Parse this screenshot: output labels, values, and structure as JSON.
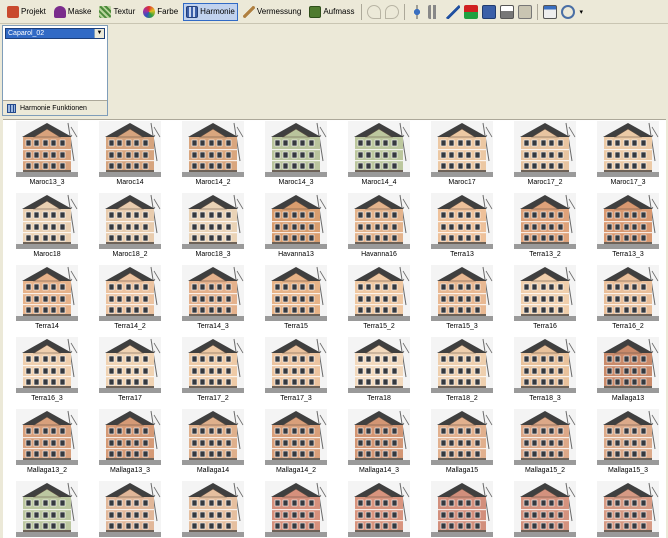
{
  "toolbar": {
    "items": [
      {
        "label": "Projekt",
        "icon": "projekt-icon",
        "color": "#c94a2e"
      },
      {
        "label": "Maske",
        "icon": "mask-icon",
        "color": "#7a2c8c"
      },
      {
        "label": "Textur",
        "icon": "texture-icon",
        "color": "#4b8b3a"
      },
      {
        "label": "Farbe",
        "icon": "color-wheel-icon",
        "color": "#e0a020"
      },
      {
        "label": "Harmonie",
        "icon": "harmony-icon",
        "color": "#3c5fa8",
        "active": true
      },
      {
        "label": "Vermessung",
        "icon": "measure-icon",
        "color": "#b08040"
      },
      {
        "label": "Aufmass",
        "icon": "aufmass-icon",
        "color": "#4f7b2e"
      }
    ]
  },
  "panel": {
    "selected_palette": "Caparol_02",
    "footer_label": "Harmonie Funktionen"
  },
  "gallery": {
    "items": [
      {
        "label": "Maroc13_3",
        "color": "#d8a27c"
      },
      {
        "label": "Maroc14",
        "color": "#d6a47e"
      },
      {
        "label": "Maroc14_2",
        "color": "#d9a67e"
      },
      {
        "label": "Maroc14_3",
        "color": "#b9c49c"
      },
      {
        "label": "Maroc14_4",
        "color": "#bcc79e"
      },
      {
        "label": "Maroc17",
        "color": "#ecc8a3"
      },
      {
        "label": "Maroc17_2",
        "color": "#e8c4a0"
      },
      {
        "label": "Maroc17_3",
        "color": "#eccaa6"
      },
      {
        "label": "Maroc18",
        "color": "#ead0b2"
      },
      {
        "label": "Maroc18_2",
        "color": "#e8ccae"
      },
      {
        "label": "Maroc18_3",
        "color": "#ead3b6"
      },
      {
        "label": "Havanna13",
        "color": "#d99d6e"
      },
      {
        "label": "Havanna16",
        "color": "#e3b38c"
      },
      {
        "label": "Terra13",
        "color": "#eec19a"
      },
      {
        "label": "Terra13_2",
        "color": "#dea27a"
      },
      {
        "label": "Terra13_3",
        "color": "#d89870"
      },
      {
        "label": "Terra14",
        "color": "#e6b28a"
      },
      {
        "label": "Terra14_2",
        "color": "#ecc3a0"
      },
      {
        "label": "Terra14_3",
        "color": "#e4b18c"
      },
      {
        "label": "Terra15",
        "color": "#e7b387"
      },
      {
        "label": "Terra15_2",
        "color": "#efc8a2"
      },
      {
        "label": "Terra15_3",
        "color": "#e8b892"
      },
      {
        "label": "Terra16",
        "color": "#f0cfac"
      },
      {
        "label": "Terra16_2",
        "color": "#e9bf9a"
      },
      {
        "label": "Terra16_3",
        "color": "#efcfae"
      },
      {
        "label": "Terra17",
        "color": "#f0d3b3"
      },
      {
        "label": "Terra17_2",
        "color": "#eecaa6"
      },
      {
        "label": "Terra17_3",
        "color": "#ecc4a0"
      },
      {
        "label": "Terra18",
        "color": "#f2d9bd"
      },
      {
        "label": "Terra18_2",
        "color": "#eecfae"
      },
      {
        "label": "Terra18_3",
        "color": "#e9c29c"
      },
      {
        "label": "Mallaga13",
        "color": "#c98a6a"
      },
      {
        "label": "Mallaga13_2",
        "color": "#d8a07c"
      },
      {
        "label": "Mallaga13_3",
        "color": "#d59a76"
      },
      {
        "label": "Mallaga14",
        "color": "#dfb08c"
      },
      {
        "label": "Mallaga14_2",
        "color": "#d99f7a"
      },
      {
        "label": "Mallaga14_3",
        "color": "#d39674"
      },
      {
        "label": "Mallaga15",
        "color": "#e1b08e"
      },
      {
        "label": "Mallaga15_2",
        "color": "#dca888"
      },
      {
        "label": "Mallaga15_3",
        "color": "#dcaa8a"
      },
      {
        "label": "",
        "color": "#bcc7a0"
      },
      {
        "label": "",
        "color": "#e1b799"
      },
      {
        "label": "",
        "color": "#e5bf9f"
      },
      {
        "label": "",
        "color": "#d6907c"
      },
      {
        "label": "",
        "color": "#d8947e"
      },
      {
        "label": "",
        "color": "#d28f7c"
      },
      {
        "label": "",
        "color": "#d4927e"
      },
      {
        "label": "",
        "color": "#d69a84"
      }
    ]
  }
}
